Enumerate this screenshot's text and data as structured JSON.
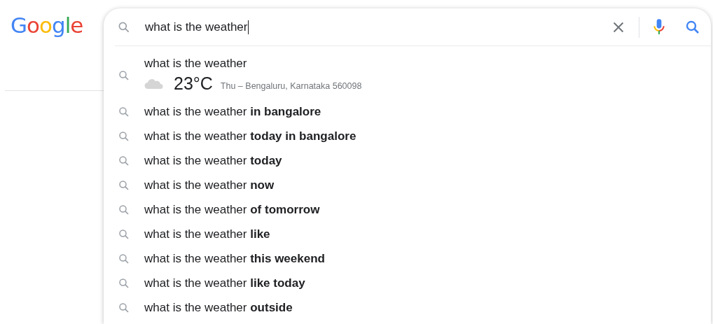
{
  "logo": "Google",
  "search": {
    "value": "what is the weather"
  },
  "weather_suggestion": {
    "query": "what is the weather",
    "temperature": "23°C",
    "details": "Thu – Bengaluru, Karnataka 560098"
  },
  "suggestions": [
    {
      "text": "what is the weather **in bangalore**"
    },
    {
      "text": "what is the weather **today in bangalore**"
    },
    {
      "text": "what is the weather **today**"
    },
    {
      "text": "what is the weather **now**"
    },
    {
      "text": "what is the weather **of tomorrow**"
    },
    {
      "text": "what is the weather **like**"
    },
    {
      "text": "what is the weather **this weekend**"
    },
    {
      "text": "what is the weather **like today**"
    },
    {
      "text": "what is the weather **outside**"
    }
  ]
}
